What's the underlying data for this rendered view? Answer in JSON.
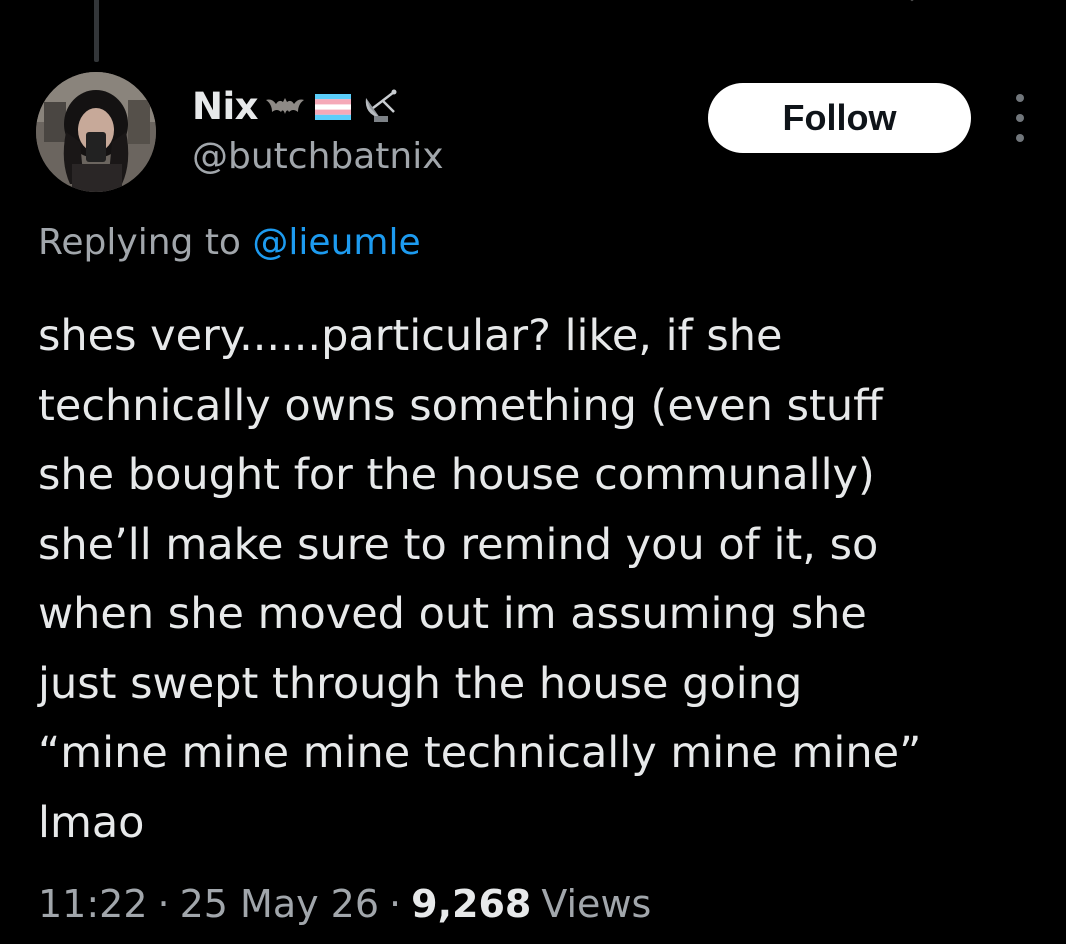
{
  "author": {
    "display_name": "Nix",
    "handle": "@butchbatnix",
    "name_emojis": [
      "bat-emoji",
      "transgender-flag-emoji",
      "satellite-antenna-emoji"
    ]
  },
  "actions": {
    "follow_label": "Follow",
    "more_icon": "more-vertical-icon"
  },
  "reply": {
    "prefix": "Replying to",
    "target": "@lieumle"
  },
  "tweet": {
    "lines": [
      "shes very......particular? like, if she",
      "technically owns something (even stuff",
      "she bought for the house communally)",
      "she’ll make sure to remind you of it, so",
      "when she moved out im assuming she",
      "just swept through the house going",
      "“mine mine mine technically mine mine”",
      "lmao"
    ]
  },
  "meta": {
    "time": "11:22",
    "date": "25 May 26",
    "separator": "·",
    "views_count": "9,268",
    "views_label": "Views"
  },
  "colors": {
    "background": "#000000",
    "text_primary": "#e7e9ea",
    "text_secondary": "#a1a6ab",
    "link": "#1d9bf0",
    "follow_bg": "#ffffff",
    "follow_text": "#0f1419"
  }
}
